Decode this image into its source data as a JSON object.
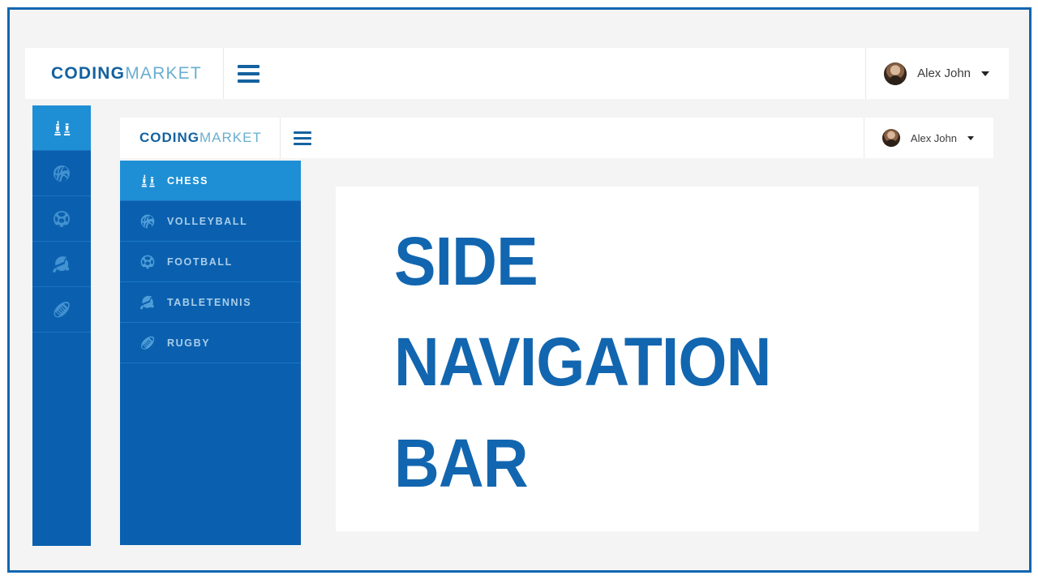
{
  "theme": {
    "frame_border": "#1266b0",
    "page_bg": "#f4f4f4",
    "sidebar_bg": "#0a60ae",
    "sidebar_active_bg": "#1e8fd4",
    "brand_dark": "#13619f",
    "brand_light": "#6aaed0",
    "headline_color": "#1266b0"
  },
  "outer_header": {
    "brand_bold": "CODING",
    "brand_light": "MARKET",
    "menu_icon": "hamburger-icon",
    "user": {
      "avatar_icon": "user-avatar",
      "name": "Alex John",
      "dropdown_icon": "chevron-down-icon"
    }
  },
  "icon_rail": {
    "items": [
      {
        "icon": "chess-icon",
        "label": "Chess",
        "active": true
      },
      {
        "icon": "volleyball-icon",
        "label": "Volleyball",
        "active": false
      },
      {
        "icon": "football-icon",
        "label": "Football",
        "active": false
      },
      {
        "icon": "tabletennis-icon",
        "label": "Tabletennis",
        "active": false
      },
      {
        "icon": "rugby-icon",
        "label": "Rugby",
        "active": false
      }
    ]
  },
  "inner_header": {
    "brand_bold": "CODING",
    "brand_light": "MARKET",
    "menu_icon": "hamburger-icon",
    "user": {
      "avatar_icon": "user-avatar",
      "name": "Alex John",
      "dropdown_icon": "chevron-down-icon"
    }
  },
  "inner_sidebar": {
    "items": [
      {
        "icon": "chess-icon",
        "label": "CHESS",
        "active": true
      },
      {
        "icon": "volleyball-icon",
        "label": "VOLLEYBALL",
        "active": false
      },
      {
        "icon": "football-icon",
        "label": "FOOTBALL",
        "active": false
      },
      {
        "icon": "tabletennis-icon",
        "label": "TABLETENNIS",
        "active": false
      },
      {
        "icon": "rugby-icon",
        "label": "RUGBY",
        "active": false
      }
    ]
  },
  "content": {
    "headline_line1": "SIDE",
    "headline_line2": "NAVIGATION",
    "headline_line3": "BAR"
  }
}
